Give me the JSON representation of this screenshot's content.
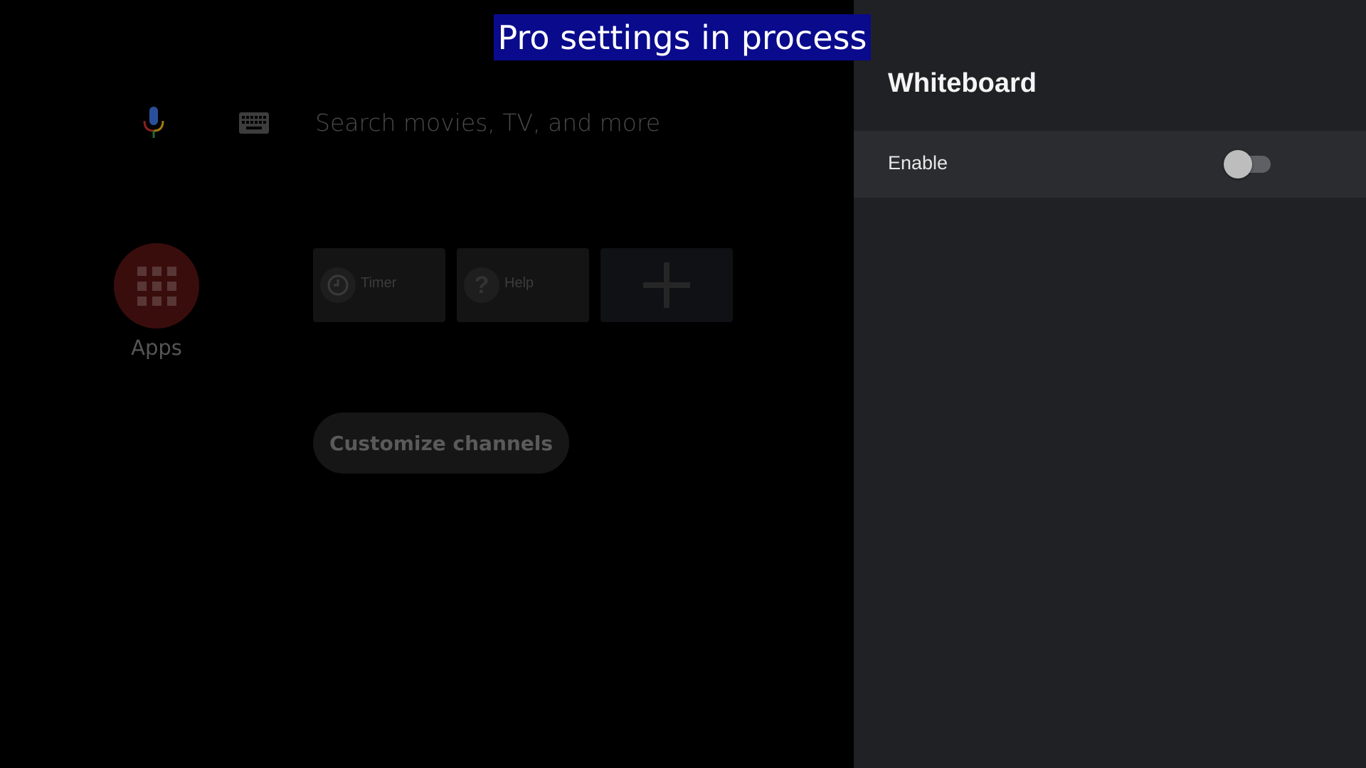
{
  "toast": {
    "text": "Pro settings in process"
  },
  "search": {
    "placeholder": "Search movies, TV, and more"
  },
  "icons": {
    "mic": "microphone-icon",
    "keyboard": "keyboard-icon",
    "apps": "apps-grid-icon",
    "timer": "timer-icon",
    "help": "help-icon",
    "add": "plus-icon"
  },
  "apps": {
    "label": "Apps"
  },
  "favorites": [
    {
      "label": "Timer"
    },
    {
      "label": "Help"
    },
    {
      "label": ""
    }
  ],
  "customize": {
    "label": "Customize channels"
  },
  "panel": {
    "title": "Whiteboard",
    "settings": [
      {
        "label": "Enable",
        "enabled": false
      }
    ]
  },
  "colors": {
    "toast_bg": "#0a0a8c",
    "panel_bg": "#202124",
    "row_bg": "#2b2c2f",
    "apps_bg": "#3a0d0d"
  }
}
